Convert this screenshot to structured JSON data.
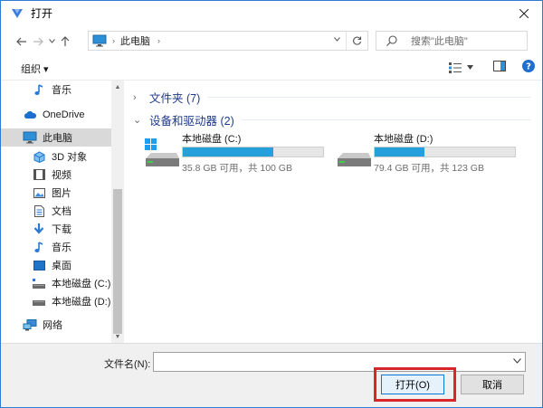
{
  "window": {
    "title": "打开",
    "accent": "#2f7bd3"
  },
  "navigation": {
    "back_icon": "back-arrow-icon",
    "forward_icon": "forward-arrow-icon",
    "up_icon": "up-arrow-icon",
    "address": {
      "separator": "›",
      "crumb": "此电脑"
    },
    "search_placeholder": "搜索\"此电脑\""
  },
  "toolbar": {
    "organize_label": "组织 ▾"
  },
  "sidebar": {
    "items": [
      {
        "label": "音乐"
      },
      {
        "label": "OneDrive"
      },
      {
        "label": "此电脑"
      },
      {
        "label": "3D 对象"
      },
      {
        "label": "视频"
      },
      {
        "label": "图片"
      },
      {
        "label": "文档"
      },
      {
        "label": "下载"
      },
      {
        "label": "音乐"
      },
      {
        "label": "桌面"
      },
      {
        "label": "本地磁盘 (C:)"
      },
      {
        "label": "本地磁盘 (D:)"
      },
      {
        "label": "网络"
      }
    ]
  },
  "main": {
    "groups": [
      {
        "label": "文件夹 (7)"
      },
      {
        "label": "设备和驱动器 (2)"
      }
    ],
    "drives": [
      {
        "name": "本地磁盘 (C:)",
        "free": "35.8 GB 可用，共 100 GB",
        "used_fraction": 0.642
      },
      {
        "name": "本地磁盘 (D:)",
        "free": "79.4 GB 可用，共 123 GB",
        "used_fraction": 0.354
      }
    ]
  },
  "footer": {
    "filename_label": "文件名(N):",
    "filename_value": "",
    "open_label": "打开(O)",
    "cancel_label": "取消",
    "highlight_color": "#d8262a"
  }
}
